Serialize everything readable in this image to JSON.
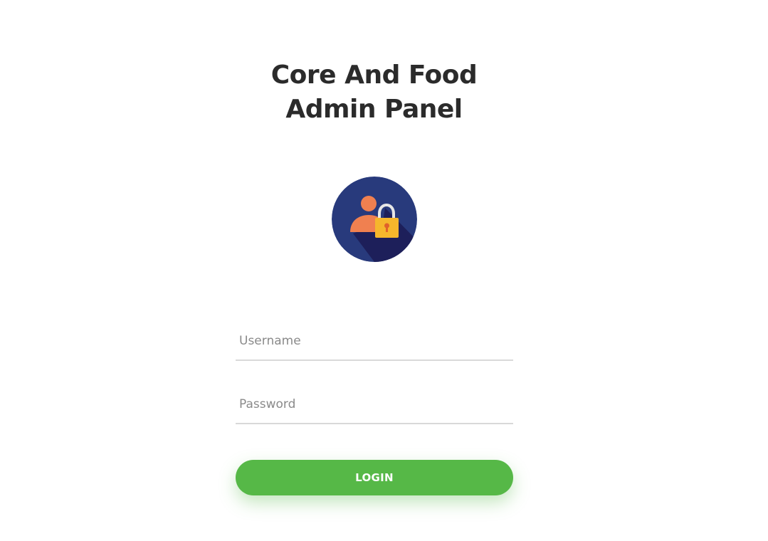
{
  "header": {
    "title_line_1": "Core And Food",
    "title_line_2": "Admin Panel"
  },
  "avatar": {
    "icon": "user-lock-icon",
    "colors": {
      "background": "#283a7c",
      "shadow": "#1d1f5a",
      "person": "#f08050",
      "lock_body": "#f5b62c",
      "lock_shackle": "#e6e6e6",
      "keyhole": "#e0622a"
    }
  },
  "form": {
    "username": {
      "placeholder": "Username",
      "value": ""
    },
    "password": {
      "placeholder": "Password",
      "value": ""
    },
    "login_label": "LOGIN"
  },
  "colors": {
    "accent": "#56b847",
    "title_text": "#2b2b2b",
    "input_border": "#d9d9d9",
    "placeholder": "#8a8a8a"
  }
}
